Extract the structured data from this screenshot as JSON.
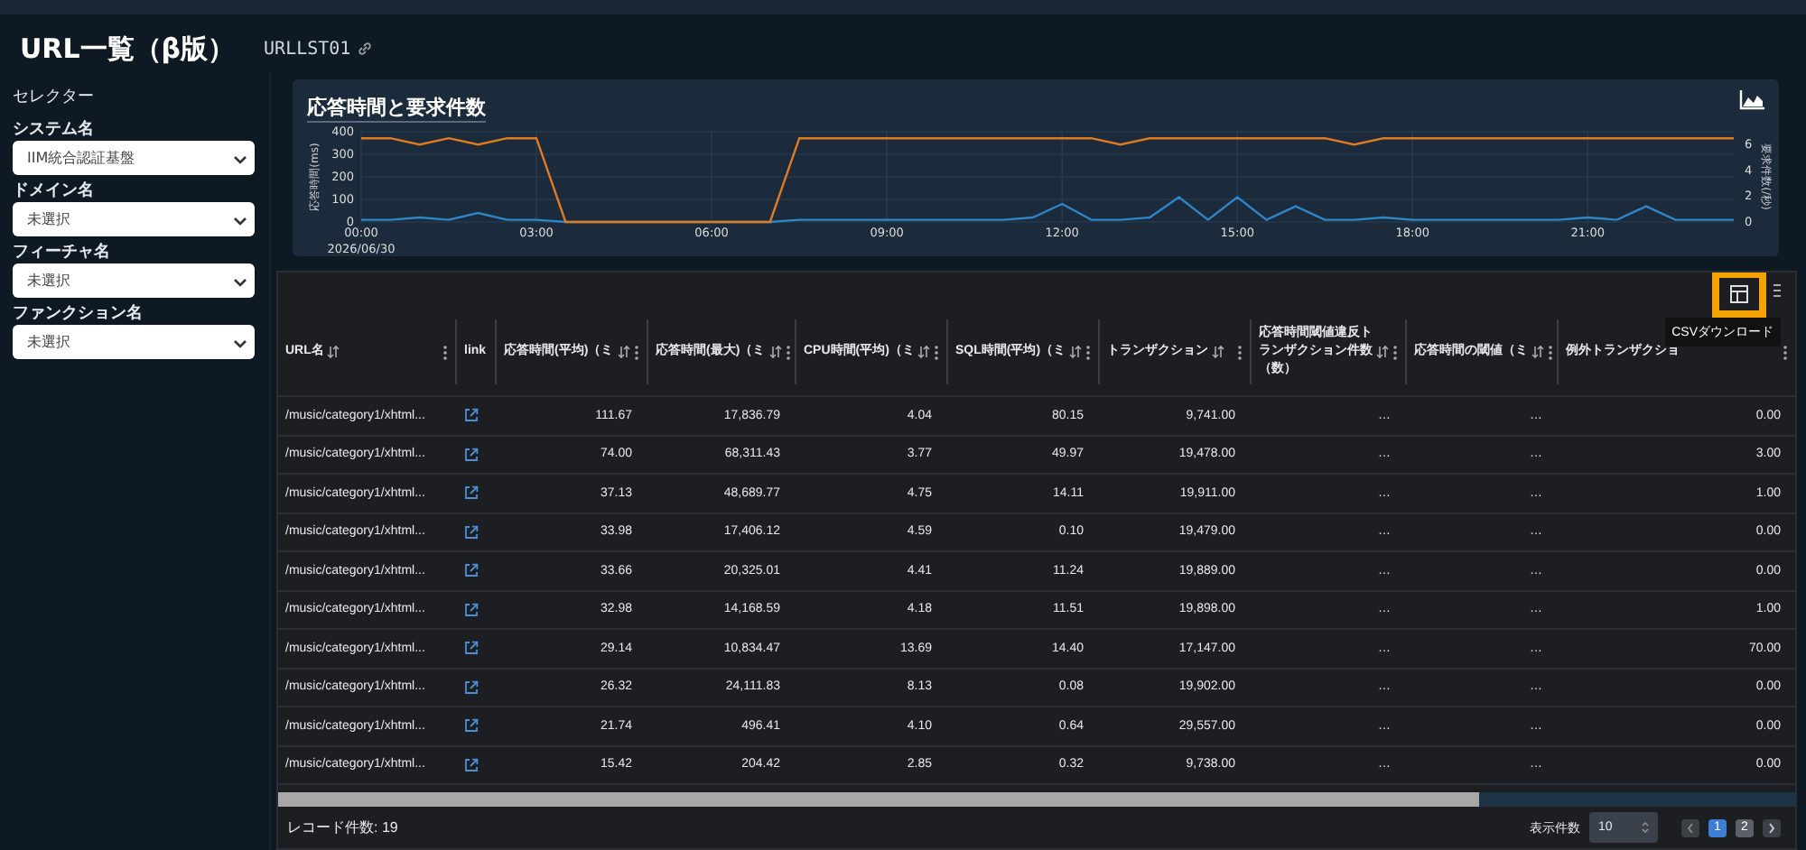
{
  "page": {
    "title": "URL一覧（β版）",
    "code": "URLLST01"
  },
  "sidebar": {
    "heading": "セレクター",
    "filters": [
      {
        "label": "システム名",
        "value": "IIM統合認証基盤"
      },
      {
        "label": "ドメイン名",
        "value": "未選択"
      },
      {
        "label": "フィーチャ名",
        "value": "未選択"
      },
      {
        "label": "ファンクション名",
        "value": "未選択"
      }
    ]
  },
  "chart_panel": {
    "title": "応答時間と要求件数",
    "date_label": "2026/06/30",
    "chart_data": {
      "type": "line",
      "grid": true,
      "ylabel": "応答時間(ms)",
      "y2label": "要求件数(/秒)",
      "ylim": [
        0,
        400
      ],
      "y2lim": [
        0,
        7
      ],
      "yticks": [
        0,
        100,
        200,
        300,
        400
      ],
      "y2ticks": [
        0,
        2,
        4,
        6
      ],
      "xlim": [
        0,
        23.5
      ],
      "xticks": [
        {
          "value": 0,
          "label": "00:00"
        },
        {
          "value": 3,
          "label": "03:00"
        },
        {
          "value": 6,
          "label": "06:00"
        },
        {
          "value": 9,
          "label": "09:00"
        },
        {
          "value": 12,
          "label": "12:00"
        },
        {
          "value": 15,
          "label": "15:00"
        },
        {
          "value": 18,
          "label": "18:00"
        },
        {
          "value": 21,
          "label": "21:00"
        }
      ],
      "x": [
        0,
        0.5,
        1,
        1.5,
        2,
        2.5,
        3,
        3.5,
        4,
        4.5,
        5,
        5.5,
        6,
        6.5,
        7,
        7.5,
        8,
        8.5,
        9,
        9.5,
        10,
        10.5,
        11,
        11.5,
        12,
        12.5,
        13,
        13.5,
        14,
        14.5,
        15,
        15.5,
        16,
        16.5,
        17,
        17.5,
        18,
        18.5,
        19,
        19.5,
        20,
        20.5,
        21,
        21.5,
        22,
        22.5,
        23,
        23.5
      ],
      "series": [
        {
          "color": "#2e86c8",
          "values": [
            10,
            10,
            20,
            10,
            40,
            10,
            10,
            0,
            0,
            0,
            0,
            0,
            0,
            0,
            0,
            10,
            10,
            10,
            10,
            10,
            10,
            10,
            10,
            20,
            80,
            10,
            10,
            20,
            110,
            10,
            110,
            10,
            70,
            10,
            10,
            20,
            10,
            10,
            10,
            10,
            10,
            10,
            20,
            10,
            70,
            10,
            10,
            10
          ]
        },
        {
          "color": "#e07b20",
          "axis": "y2",
          "values": [
            6.5,
            6.5,
            6,
            6.5,
            6,
            6.5,
            6.5,
            0,
            0,
            0,
            0,
            0,
            0,
            0,
            0,
            6.5,
            6.5,
            6.5,
            6.5,
            6.5,
            6.5,
            6.5,
            6.5,
            6.5,
            6.5,
            6.5,
            6,
            6.5,
            6.5,
            6.5,
            6.5,
            6.5,
            6.5,
            6.5,
            6,
            6.5,
            6.5,
            6.5,
            6.5,
            6.5,
            6.5,
            6.5,
            6.5,
            6.5,
            6.5,
            6.5,
            6.5,
            6.5
          ]
        }
      ]
    }
  },
  "table": {
    "tooltip": "CSVダウンロード",
    "columns": [
      {
        "label": "URL名",
        "sortable": true
      },
      {
        "label": "link",
        "sortable": false
      },
      {
        "label": "応答時間(平均)（ミ",
        "sortable": true
      },
      {
        "label": "応答時間(最大)（ミ",
        "sortable": true
      },
      {
        "label": "CPU時間(平均)（ミ",
        "sortable": true
      },
      {
        "label": "SQL時間(平均)（ミ",
        "sortable": true
      },
      {
        "label": "トランザクション",
        "sortable": true
      },
      {
        "label": "応答時間閾値違反トランザクション件数（数）",
        "sortable": true
      },
      {
        "label": "応答時間の閾値（ミ",
        "sortable": true
      },
      {
        "label": "例外トランザクショ",
        "sortable": false
      }
    ],
    "rows": [
      [
        "/music/category1/xhtml...",
        "",
        "111.67",
        "17,836.79",
        "4.04",
        "80.15",
        "9,741.00",
        "…",
        "…",
        "0.00"
      ],
      [
        "/music/category1/xhtml...",
        "",
        "74.00",
        "68,311.43",
        "3.77",
        "49.97",
        "19,478.00",
        "…",
        "…",
        "3.00"
      ],
      [
        "/music/category1/xhtml...",
        "",
        "37.13",
        "48,689.77",
        "4.75",
        "14.11",
        "19,911.00",
        "…",
        "…",
        "1.00"
      ],
      [
        "/music/category1/xhtml...",
        "",
        "33.98",
        "17,406.12",
        "4.59",
        "0.10",
        "19,479.00",
        "…",
        "…",
        "0.00"
      ],
      [
        "/music/category1/xhtml...",
        "",
        "33.66",
        "20,325.01",
        "4.41",
        "11.24",
        "19,889.00",
        "…",
        "…",
        "0.00"
      ],
      [
        "/music/category1/xhtml...",
        "",
        "32.98",
        "14,168.59",
        "4.18",
        "11.51",
        "19,898.00",
        "…",
        "…",
        "1.00"
      ],
      [
        "/music/category1/xhtml...",
        "",
        "29.14",
        "10,834.47",
        "13.69",
        "14.40",
        "17,147.00",
        "…",
        "…",
        "70.00"
      ],
      [
        "/music/category1/xhtml...",
        "",
        "26.32",
        "24,111.83",
        "8.13",
        "0.08",
        "19,902.00",
        "…",
        "…",
        "0.00"
      ],
      [
        "/music/category1/xhtml...",
        "",
        "21.74",
        "496.41",
        "4.10",
        "0.64",
        "29,557.00",
        "…",
        "…",
        "0.00"
      ],
      [
        "/music/category1/xhtml...",
        "",
        "15.42",
        "204.42",
        "2.85",
        "0.32",
        "9,738.00",
        "…",
        "…",
        "0.00"
      ]
    ],
    "record_count": "レコード件数: 19",
    "page_size_label": "表示件数",
    "page_size": "10",
    "pages": [
      {
        "label": "1",
        "selected": true
      },
      {
        "label": "2",
        "selected": false
      }
    ]
  }
}
